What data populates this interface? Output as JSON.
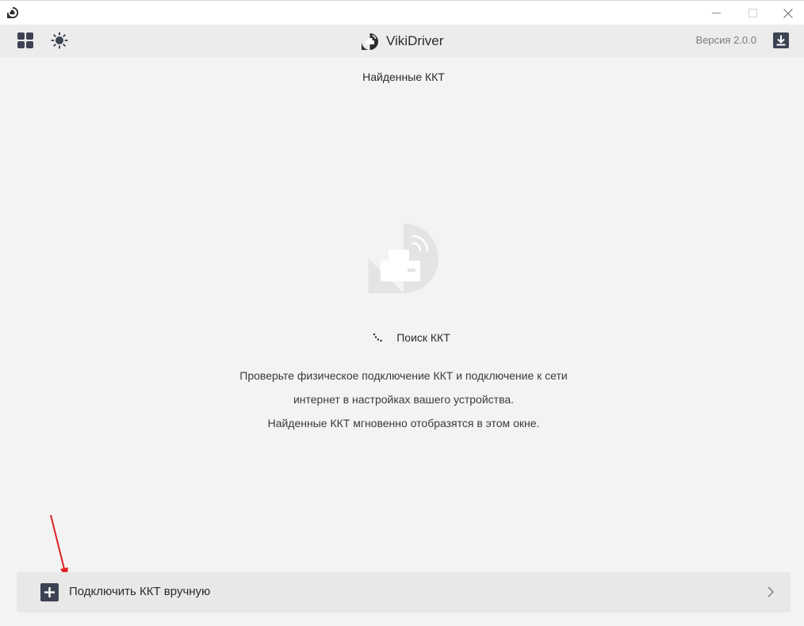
{
  "titlebar": {
    "icons": [
      "app-icon",
      "minimize-icon",
      "maximize-icon",
      "close-icon"
    ]
  },
  "toolbar": {
    "app_name": "VikiDriver",
    "version": "Версия 2.0.0",
    "icons": [
      "grid-icon",
      "sun-icon",
      "vikidriver-logo-icon",
      "download-icon"
    ]
  },
  "main": {
    "title": "Найденные ККТ",
    "status": "Поиск ККТ",
    "hint_lines": [
      "Проверьте физическое подключение ККТ и подключение к сети",
      "интернет в настройках вашего устройства.",
      "Найденные ККТ мгновенно отобразятся в этом окне."
    ],
    "illustration": "printer-wireless-icon"
  },
  "footer": {
    "manual_connect_label": "Подключить ККТ вручную",
    "icons": [
      "plus-icon",
      "chevron-right-icon"
    ]
  },
  "colors": {
    "annotation_arrow": "#e02020",
    "icon_dark": "#3d4352",
    "illustration_bg": "#e4e4e4"
  }
}
